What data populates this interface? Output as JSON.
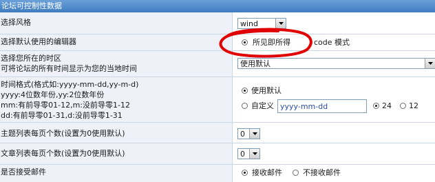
{
  "header": {
    "title": "论坛可控制性数据"
  },
  "rows": {
    "style": {
      "label": "选择风格",
      "select_value": "wind"
    },
    "editor": {
      "label": "选择默认使用的编辑器",
      "option_wysiwyg": "所见即所得",
      "option_code": "code 模式",
      "selected": "wysiwyg",
      "annotation_color": "#e00000"
    },
    "timezone": {
      "label_line1": "选择您所在的时区",
      "label_line2": "可将论坛的所有时间显示为您的当地时间",
      "select_value": "使用默认"
    },
    "timeformat": {
      "label_lines": [
        "时间格式(格式如:yyyy-mm-dd,yy-m-d)",
        "yyyy:4位数年份,yy:2位数年份",
        "mm:有前导零01-12,m:没前导零1-12",
        "dd:有前导零01-31,d:没前导零1-31"
      ],
      "option_default": "使用默认",
      "option_custom": "自定义",
      "custom_value": "yyyy-mm-dd",
      "option_24": "24",
      "option_12": "12",
      "selected_format": "default",
      "selected_clock": "24"
    },
    "topics_per_page": {
      "label": "主题列表每页个数(设置为0使用默认)",
      "select_value": "0"
    },
    "posts_per_page": {
      "label": "文章列表每页个数(设置为0使用默认)",
      "select_value": "0"
    },
    "email": {
      "label": "是否接受邮件",
      "option_accept": "接收邮件",
      "option_reject": "不接收邮件",
      "selected": "accept"
    }
  }
}
